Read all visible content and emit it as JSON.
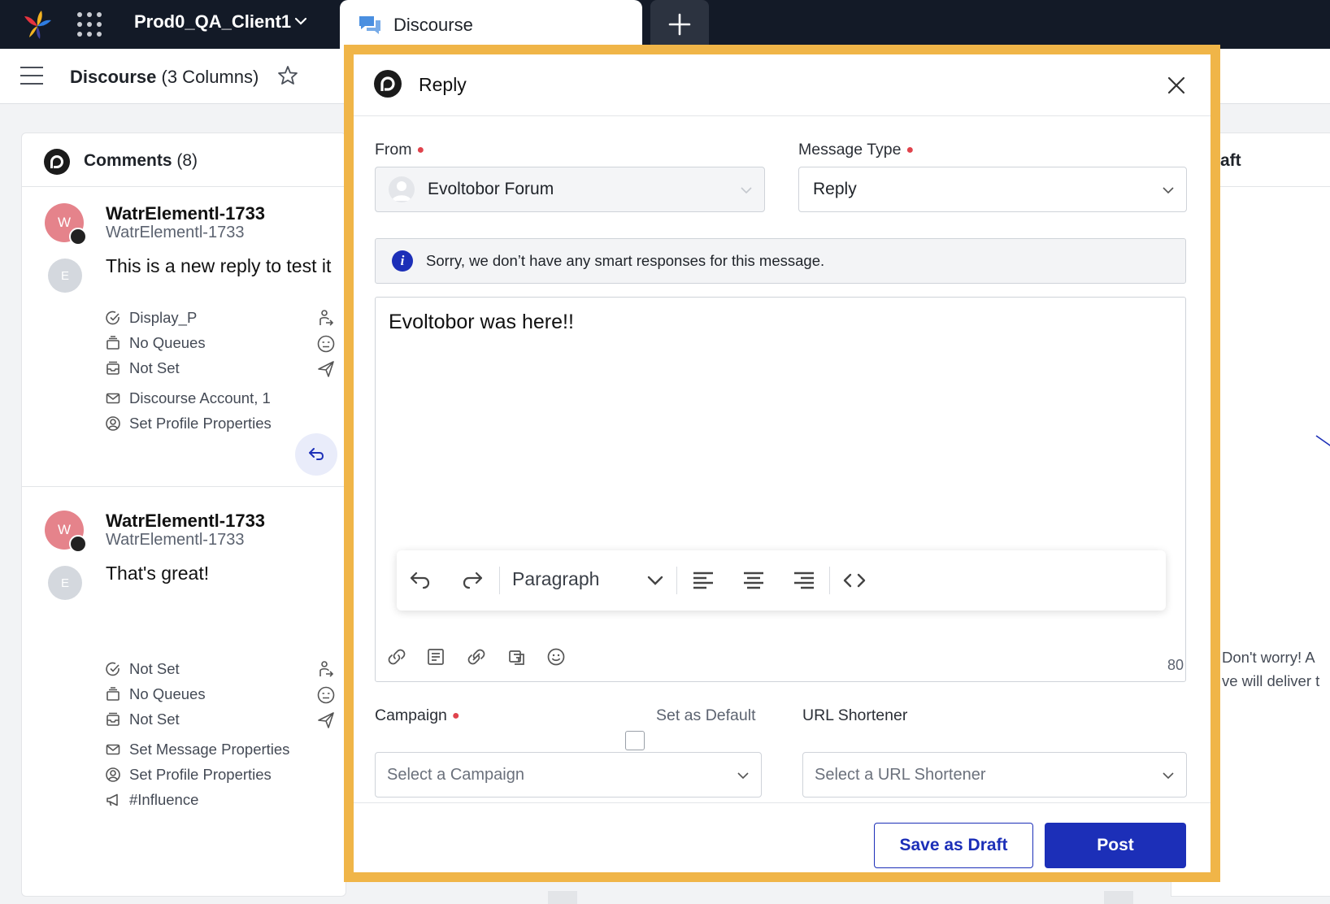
{
  "topbar": {
    "workspace": "Prod0_QA_Client1",
    "active_tab": "Discourse"
  },
  "subheader": {
    "title_bold": "Discourse",
    "title_rest": " (3 Columns)"
  },
  "left_column": {
    "title_bold": "Comments",
    "title_rest": " (8)",
    "posts": [
      {
        "avatar_initial": "W",
        "secondary_initial": "E",
        "name": "WatrElementl-1733",
        "handle": "WatrElementl-1733",
        "message": "This is a new reply to test it",
        "props": [
          "Display_P",
          "No Queues",
          "Not Set",
          "Discourse Account, 1",
          "Set Profile Properties"
        ]
      },
      {
        "avatar_initial": "W",
        "secondary_initial": "E",
        "name": "WatrElementl-1733",
        "handle": "WatrElementl-1733",
        "message": "That's great!",
        "props": [
          "Not Set",
          "No Queues",
          "Not Set",
          "Set Message Properties",
          "Set Profile Properties",
          "#Influence"
        ]
      }
    ]
  },
  "right_column": {
    "title_fragment": "aft",
    "text_line1": "Don't worry! A",
    "text_line2": "ve will deliver t"
  },
  "modal": {
    "title": "Reply",
    "from_label": "From",
    "from_value": "Evoltobor Forum",
    "message_type_label": "Message Type",
    "message_type_value": "Reply",
    "info_text": "Sorry, we don’t have any smart responses for this message.",
    "editor_text": "Evoltobor was here!!",
    "paragraph_style": "Paragraph",
    "char_count": "80",
    "campaign_label": "Campaign",
    "set_default_label": "Set as Default",
    "campaign_placeholder": "Select a Campaign",
    "url_shortener_label": "URL Shortener",
    "url_shortener_placeholder": "Select a URL Shortener",
    "save_draft_label": "Save as Draft",
    "post_label": "Post"
  },
  "colors": {
    "topbar": "#131a27",
    "accent": "#1c2fb8",
    "highlight_frame": "#f0b548",
    "required": "#e0434c",
    "avatar": "#e5838b"
  }
}
